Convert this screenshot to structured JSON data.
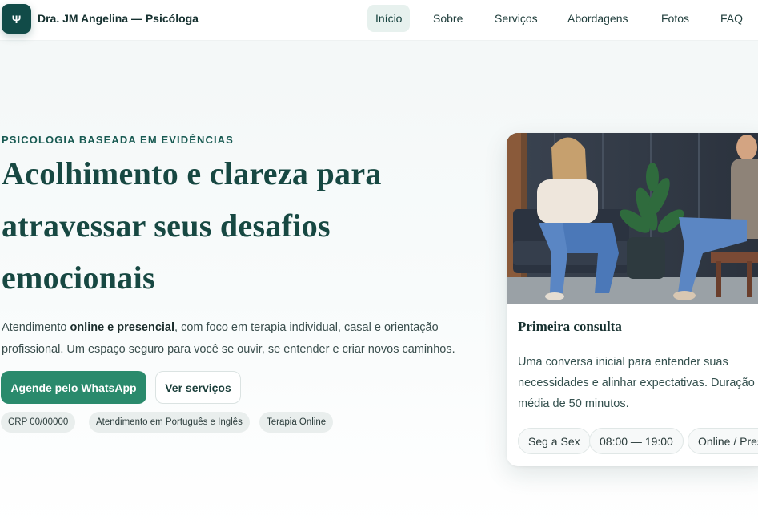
{
  "header": {
    "logo_glyph": "Ψ",
    "brand": "Dra. JM Angelina — Psicóloga",
    "nav": [
      {
        "label": "Início",
        "active": true
      },
      {
        "label": "Sobre"
      },
      {
        "label": "Serviços"
      },
      {
        "label": "Abordagens"
      },
      {
        "label": "Fotos"
      },
      {
        "label": "FAQ"
      }
    ]
  },
  "hero": {
    "eyebrow": "PSICOLOGIA BASEADA EM EVIDÊNCIAS",
    "title": "Acolhimento e clareza para atravessar seus desafios emocionais",
    "desc_pre": "Atendimento ",
    "desc_bold": "online e presencial",
    "desc_post": ", com foco em terapia individual, casal e orientação profissional. Um espaço seguro para você se ouvir, se entender e criar novos caminhos.",
    "primary_button": "Agende pelo WhatsApp",
    "secondary_button": "Ver serviços",
    "chips": [
      "CRP 00/00000",
      "Atendimento em Português e Inglês",
      "Terapia Online"
    ]
  },
  "card": {
    "title": "Primeira consulta",
    "description": "Uma conversa inicial para entender suas necessidades e alinhar expectativas. Duração média de 50 minutos.",
    "pills": [
      "Seg a Sex",
      "08:00 — 19:00",
      "Online / Presencial"
    ]
  },
  "colors": {
    "brand_dark": "#114b48",
    "accent_green": "#2a8a6c",
    "title_green": "#174842",
    "nav_active_bg": "#e7f1ee"
  }
}
